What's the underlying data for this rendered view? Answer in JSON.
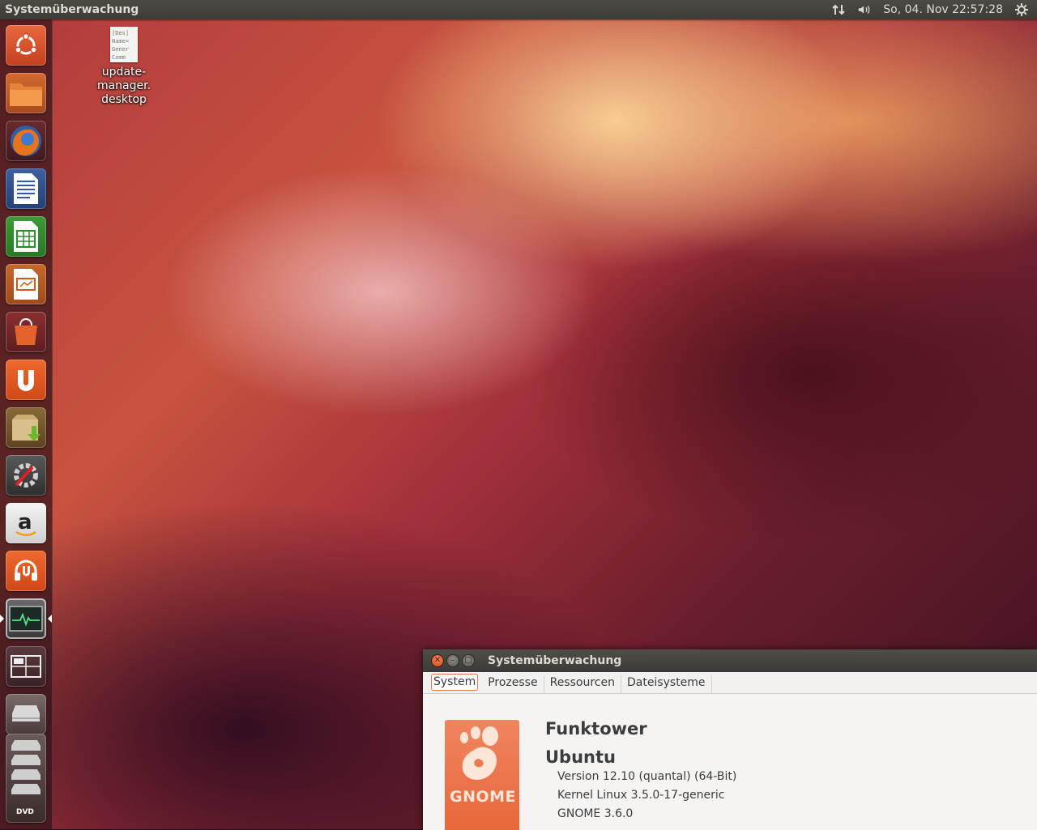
{
  "top_panel": {
    "app_title": "Systemüberwachung",
    "clock": "So, 04. Nov  22:57:28"
  },
  "launcher": {
    "items": [
      "ubuntu-dash",
      "files",
      "firefox",
      "libreoffice-writer",
      "libreoffice-calc",
      "libreoffice-impress",
      "software-center",
      "ubuntu-one",
      "update-manager",
      "system-settings",
      "amazon",
      "ubuntu-one-music",
      "system-monitor",
      "workspace-switcher",
      "drive",
      "trash"
    ]
  },
  "desktop_icon": {
    "label_line1": "update-manager.",
    "label_line2": "desktop",
    "preview_lines": [
      "[Des]",
      "Name=",
      "Gener",
      "Comm"
    ]
  },
  "window": {
    "title": "Systemüberwachung",
    "tabs": [
      "System",
      "Prozesse",
      "Ressourcen",
      "Dateisysteme"
    ],
    "hostname": "Funktower",
    "distro": "Ubuntu",
    "version": "Version 12.10 (quantal) (64-Bit)",
    "kernel": "Kernel Linux 3.5.0-17-generic",
    "gnome": "GNOME 3.6.0",
    "logo_text": "GNOME"
  }
}
